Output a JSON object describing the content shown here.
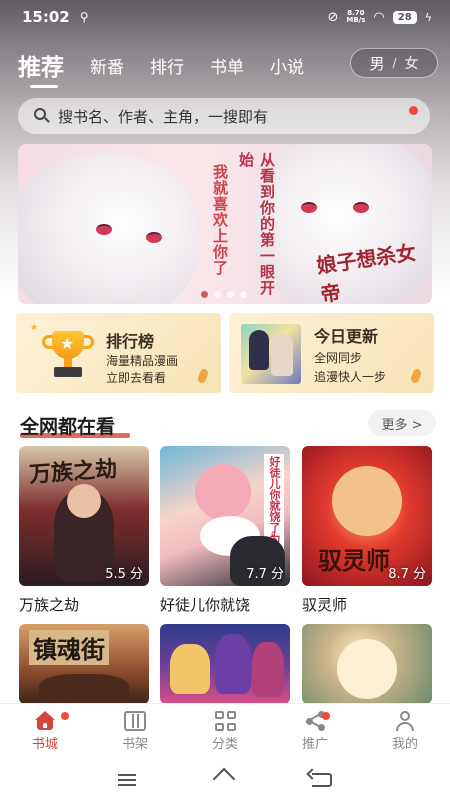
{
  "status_bar": {
    "time": "15:02",
    "net_speed_value": "8.70",
    "net_speed_unit": "MB/s",
    "battery": "28"
  },
  "nav_tabs": [
    {
      "label": "推荐",
      "active": true
    },
    {
      "label": "新番",
      "active": false
    },
    {
      "label": "排行",
      "active": false
    },
    {
      "label": "书单",
      "active": false
    },
    {
      "label": "小说",
      "active": false
    }
  ],
  "gender_toggle": {
    "male": "男",
    "separator": "/",
    "female": "女"
  },
  "search": {
    "placeholder": "搜书名、作者、主角，一搜即有"
  },
  "banner": {
    "text_line1": "从看到你的第一眼开始",
    "text_line2": "我就喜欢上你了",
    "subtitle": "娘子想杀女帝"
  },
  "feature_cards": {
    "ranking": {
      "title": "排行榜",
      "line1": "海量精品漫画",
      "line2": "立即去看看"
    },
    "update": {
      "title": "今日更新",
      "line1": "全网同步",
      "line2": "追漫快人一步"
    }
  },
  "section": {
    "title": "全网都在看",
    "more_label": "更多 >"
  },
  "comics": [
    {
      "title": "万族之劫",
      "score": "5.5 分",
      "cover_text": "万族之劫"
    },
    {
      "title": "好徒儿你就饶",
      "score": "7.7 分",
      "cover_text": "好徒儿你就饶了为师伐"
    },
    {
      "title": "驭灵师",
      "score": "8.7 分",
      "cover_text": "驭灵师"
    },
    {
      "title": "",
      "score": "",
      "cover_text": "镇魂街"
    },
    {
      "title": "",
      "score": "",
      "cover_text": ""
    },
    {
      "title": "",
      "score": "",
      "cover_text": ""
    }
  ],
  "bottom_nav": [
    {
      "label": "书城",
      "icon": "home-icon",
      "active": true
    },
    {
      "label": "书架",
      "icon": "bookshelf-icon",
      "active": false
    },
    {
      "label": "分类",
      "icon": "category-grid-icon",
      "active": false
    },
    {
      "label": "推广",
      "icon": "share-icon",
      "active": false
    },
    {
      "label": "我的",
      "icon": "user-icon",
      "active": false
    }
  ],
  "colors": {
    "accent": "#d3463b",
    "badge": "#ef4a3c",
    "card_bg": "#f8e3b7"
  }
}
